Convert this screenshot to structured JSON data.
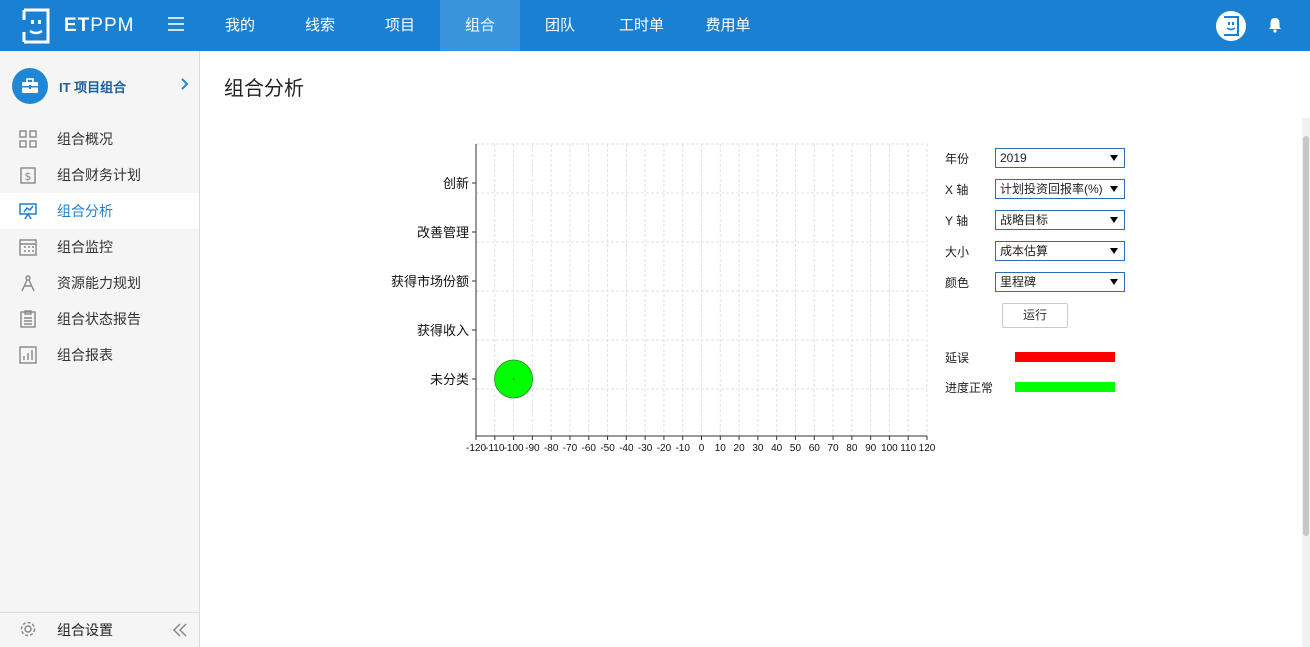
{
  "app": {
    "logo_bold": "ET",
    "logo_rest": "PPM"
  },
  "nav": {
    "items": [
      {
        "label": "我的",
        "active": false
      },
      {
        "label": "线索",
        "active": false
      },
      {
        "label": "项目",
        "active": false
      },
      {
        "label": "组合",
        "active": true
      },
      {
        "label": "团队",
        "active": false
      },
      {
        "label": "工时单",
        "active": false
      },
      {
        "label": "费用单",
        "active": false
      }
    ]
  },
  "sidebar": {
    "header": "IT 项目组合",
    "items": [
      {
        "label": "组合概况",
        "icon": "grid-icon",
        "active": false
      },
      {
        "label": "组合财务计划",
        "icon": "finance-icon",
        "active": false
      },
      {
        "label": "组合分析",
        "icon": "presentation-icon",
        "active": true
      },
      {
        "label": "组合监控",
        "icon": "calendar-icon",
        "active": false
      },
      {
        "label": "资源能力规划",
        "icon": "compass-icon",
        "active": false
      },
      {
        "label": "组合状态报告",
        "icon": "clipboard-icon",
        "active": false
      },
      {
        "label": "组合报表",
        "icon": "bar-report-icon",
        "active": false
      }
    ],
    "footer": "组合设置"
  },
  "page": {
    "title": "组合分析"
  },
  "controls": {
    "year": {
      "label": "年份",
      "value": "2019"
    },
    "x_axis": {
      "label": "X 轴",
      "value": "计划投资回报率(%)"
    },
    "y_axis": {
      "label": "Y 轴",
      "value": "战略目标"
    },
    "size": {
      "label": "大小",
      "value": "成本估算"
    },
    "color": {
      "label": "颜色",
      "value": "里程碑"
    },
    "run": "运行"
  },
  "legend": [
    {
      "label": "延误",
      "color": "#ff0000"
    },
    {
      "label": "进度正常",
      "color": "#00ff00"
    }
  ],
  "chart_data": {
    "type": "scatter",
    "title": "",
    "xlabel": "",
    "ylabel": "",
    "x_ticks": [
      -120,
      -110,
      -100,
      -90,
      -80,
      -70,
      -60,
      -50,
      -40,
      -30,
      -20,
      -10,
      0,
      10,
      20,
      30,
      40,
      50,
      60,
      70,
      80,
      90,
      100,
      110,
      120
    ],
    "xlim": [
      -120,
      120
    ],
    "categories": [
      "创新",
      "改善管理",
      "获得市场份额",
      "获得收入",
      "未分类"
    ],
    "grid": true,
    "points": [
      {
        "x": -100,
        "y": "未分类",
        "color": "#00ff00"
      }
    ]
  }
}
